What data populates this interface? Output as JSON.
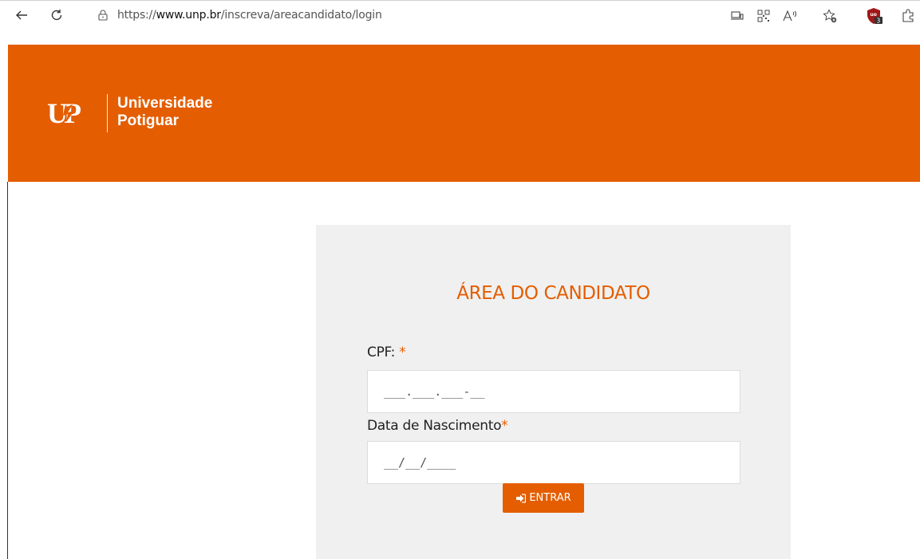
{
  "browser": {
    "url_scheme": "https://",
    "url_host": "www.unp.br",
    "url_path": "/inscreva/areacandidato/login",
    "extension_badge": "3"
  },
  "header": {
    "logo_mark": "UP",
    "logo_line1": "Universidade",
    "logo_line2": "Potiguar"
  },
  "login": {
    "title": "ÁREA DO CANDIDATO",
    "cpf_label": "CPF: ",
    "cpf_required": "*",
    "cpf_placeholder": "___.___.___-__",
    "dob_label": "Data de Nascimento",
    "dob_required": "*",
    "dob_placeholder": "__/__/____",
    "submit_label": "ENTRAR"
  },
  "colors": {
    "brand": "#e45d00",
    "panel_bg": "#f0f0f0"
  }
}
